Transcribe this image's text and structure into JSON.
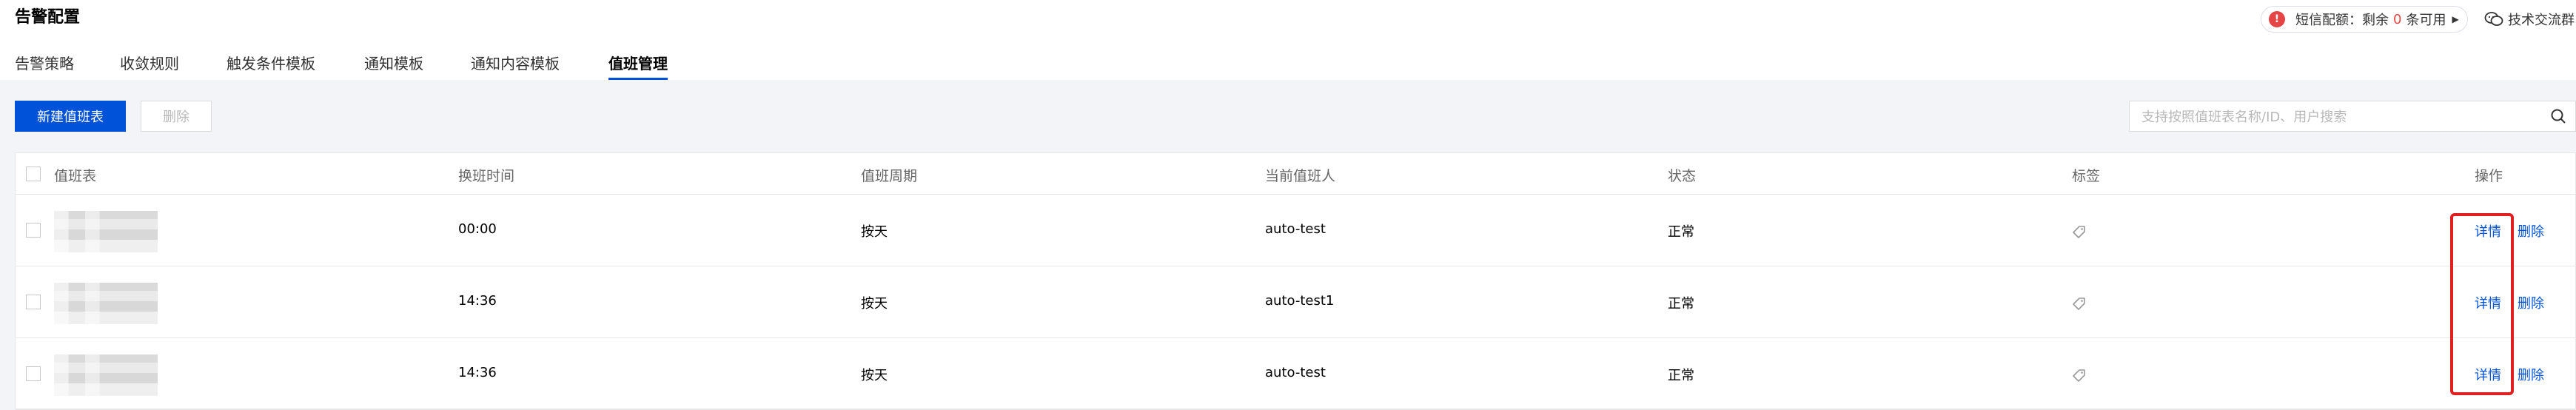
{
  "page": {
    "title": "告警配置"
  },
  "sms": {
    "label": "短信配额：剩余",
    "count": "0",
    "unit": "条可用"
  },
  "tech_group": {
    "label": "技术交流群"
  },
  "tabs": [
    {
      "label": "告警策略",
      "active": false
    },
    {
      "label": "收敛规则",
      "active": false
    },
    {
      "label": "触发条件模板",
      "active": false
    },
    {
      "label": "通知模板",
      "active": false
    },
    {
      "label": "通知内容模板",
      "active": false
    },
    {
      "label": "值班管理",
      "active": true
    }
  ],
  "toolbar": {
    "create_label": "新建值班表",
    "delete_label": "删除"
  },
  "search": {
    "placeholder": "支持按照值班表名称/ID、用户搜索"
  },
  "table": {
    "columns": [
      "值班表",
      "换班时间",
      "值班周期",
      "当前值班人",
      "状态",
      "标签",
      "操作"
    ],
    "rows": [
      {
        "shift_time": "00:00",
        "cycle": "按天",
        "on_duty": "auto-test",
        "status": "正常",
        "detail": "详情",
        "delete": "删除"
      },
      {
        "shift_time": "14:36",
        "cycle": "按天",
        "on_duty": "auto-test1",
        "status": "正常",
        "detail": "详情",
        "delete": "删除"
      },
      {
        "shift_time": "14:36",
        "cycle": "按天",
        "on_duty": "auto-test",
        "status": "正常",
        "detail": "详情",
        "delete": "删除"
      }
    ]
  },
  "colors": {
    "accent": "#0052d9",
    "danger": "#e54545",
    "highlight": "#e02020"
  }
}
